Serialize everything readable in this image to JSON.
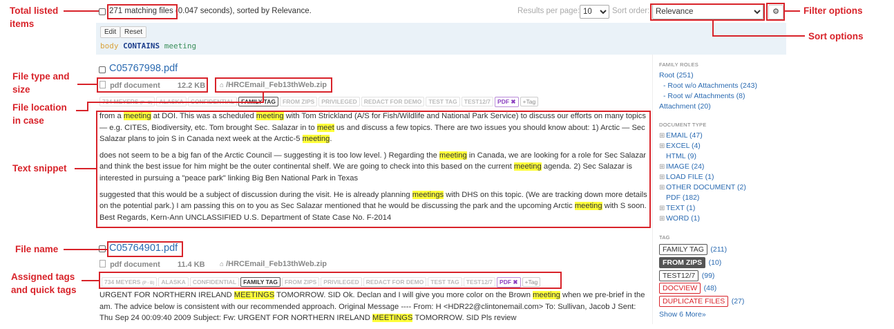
{
  "annotations": {
    "total_listed": "Total listed\nitems",
    "file_type_size": "File type and\nsize",
    "file_location": "File location\nin case",
    "text_snippet": "Text snippet",
    "file_name": "File name",
    "assigned_tags": "Assigned tags\nand quick tags",
    "filter_options": "Filter options",
    "sort_options": "Sort options"
  },
  "topbar": {
    "count": "271 matching files",
    "timing": "(0.047 seconds), sorted by ",
    "sorted_by": "Relevance",
    "results_label": "Results per page:",
    "results_value": "10",
    "sort_label": "Sort order:",
    "sort_value": "Relevance"
  },
  "query": {
    "edit_label": "Edit",
    "reset_label": "Reset",
    "field": "body",
    "operator": "CONTAINS",
    "term": "meeting"
  },
  "results": [
    {
      "name": "C05767998.pdf",
      "type": "pdf document",
      "size": "12.2 KB",
      "location": "/HRCEmail_Feb13thWeb.zip"
    },
    {
      "name": "C05764901.pdf",
      "type": "pdf document",
      "size": "11.4 KB",
      "location": "/HRCEmail_Feb13thWeb.zip"
    }
  ],
  "tags": {
    "meyers": "734 MEYERS",
    "meyers_sub": "(P - B)",
    "alaska": "ALASKA",
    "confidential": "CONFIDENTIAL",
    "family": "FAMILY TAG",
    "zips": "FROM ZIPS",
    "privileged": "PRIVILEGED",
    "redact": "REDACT FOR DEMO",
    "test": "TEST TAG",
    "test12": "TEST12/7",
    "pdf": "PDF",
    "add": "Tag"
  },
  "snippet1": {
    "p1": [
      "from a ",
      "meeting",
      " at DOI. This was a scheduled ",
      "meeting",
      " with Tom Strickland (A/S for Fish/Wildlife and National Park Service) to discuss our efforts on many topics — e.g. CITES, Biodiversity, etc. Tom brought Sec. Salazar in to ",
      "meet",
      " us and discuss a few topics. There are two issues you should know about: 1) Arctic — Sec Salazar plans to join S in Canada next week at the Arctic-5 ",
      "meeting",
      "."
    ],
    "p2": [
      "does not seem to be a big fan of the Arctic Council — suggesting it is too low level. ) Regarding the ",
      "meeting",
      " in Canada, we are looking for a role for Sec Salazar and think the best issue for him might be the outer continental shelf. We are going to check into this based on the current ",
      "meeting",
      " agenda. 2) Sec Salazar is interested in pursuing a \"peace park\" linking Big Ben National Park in Texas"
    ],
    "p3": [
      "suggested that this would be a subject of discussion during the visit. He is already planning ",
      "meetings",
      " with DHS on this topic. (We are tracking down more details on the potential park.) I am passing this on to you as Sec Salazar mentioned that he would be discussing the park and the upcoming Arctic ",
      "meeting",
      " with S soon. Best Regards, Kern-Ann UNCLASSIFIED U.S. Department of State Case No. F-2014"
    ]
  },
  "snippet2": {
    "p1": [
      "URGENT FOR NORTHERN IRELAND ",
      "MEETINGS",
      " TOMORROW. SID Ok. Declan and I will give you more color on the Brown ",
      "meeting",
      " when we pre-brief in the am. The advice below is consistent with our recommended approach. Original Message ---- From: H <HDR22@clintonemail.com> To: Sullivan, Jacob J Sent: Thu Sep 24 00:09:40 2009 Subject: Fw: URGENT FOR NORTHERN IRELAND ",
      "MEETINGS",
      " TOMORROW. SID Pls review"
    ]
  },
  "sidebar": {
    "family_roles_title": "FAMILY ROLES",
    "root": "Root (251)",
    "root_wo": "- Root w/o Attachments (243)",
    "root_w": "- Root w/ Attachments (8)",
    "attachment": "Attachment (20)",
    "doc_type_title": "DOCUMENT TYPE",
    "email": "EMAIL (47)",
    "excel": "EXCEL (4)",
    "html": "HTML (9)",
    "image": "IMAGE (24)",
    "load_file": "LOAD FILE (1)",
    "other_doc": "OTHER DOCUMENT (2)",
    "pdf": "PDF (182)",
    "text": "TEXT (1)",
    "word": "WORD (1)",
    "tag_title": "TAG",
    "tag_family": "FAMILY TAG",
    "tag_family_count": "(211)",
    "tag_zips": "FROM ZIPS",
    "tag_zips_count": "(10)",
    "tag_test": "TEST12/7",
    "tag_test_count": "(99)",
    "tag_docview": "DOCVIEW",
    "tag_docview_count": "(48)",
    "tag_dup": "DUPLICATE FILES",
    "tag_dup_count": "(27)",
    "show_more": "Show 6 More»"
  },
  "colors": {
    "annotation": "#d8232a",
    "link": "#2a6ab1",
    "highlight": "#ffff3a",
    "query_bg": "#eaf2f8"
  }
}
